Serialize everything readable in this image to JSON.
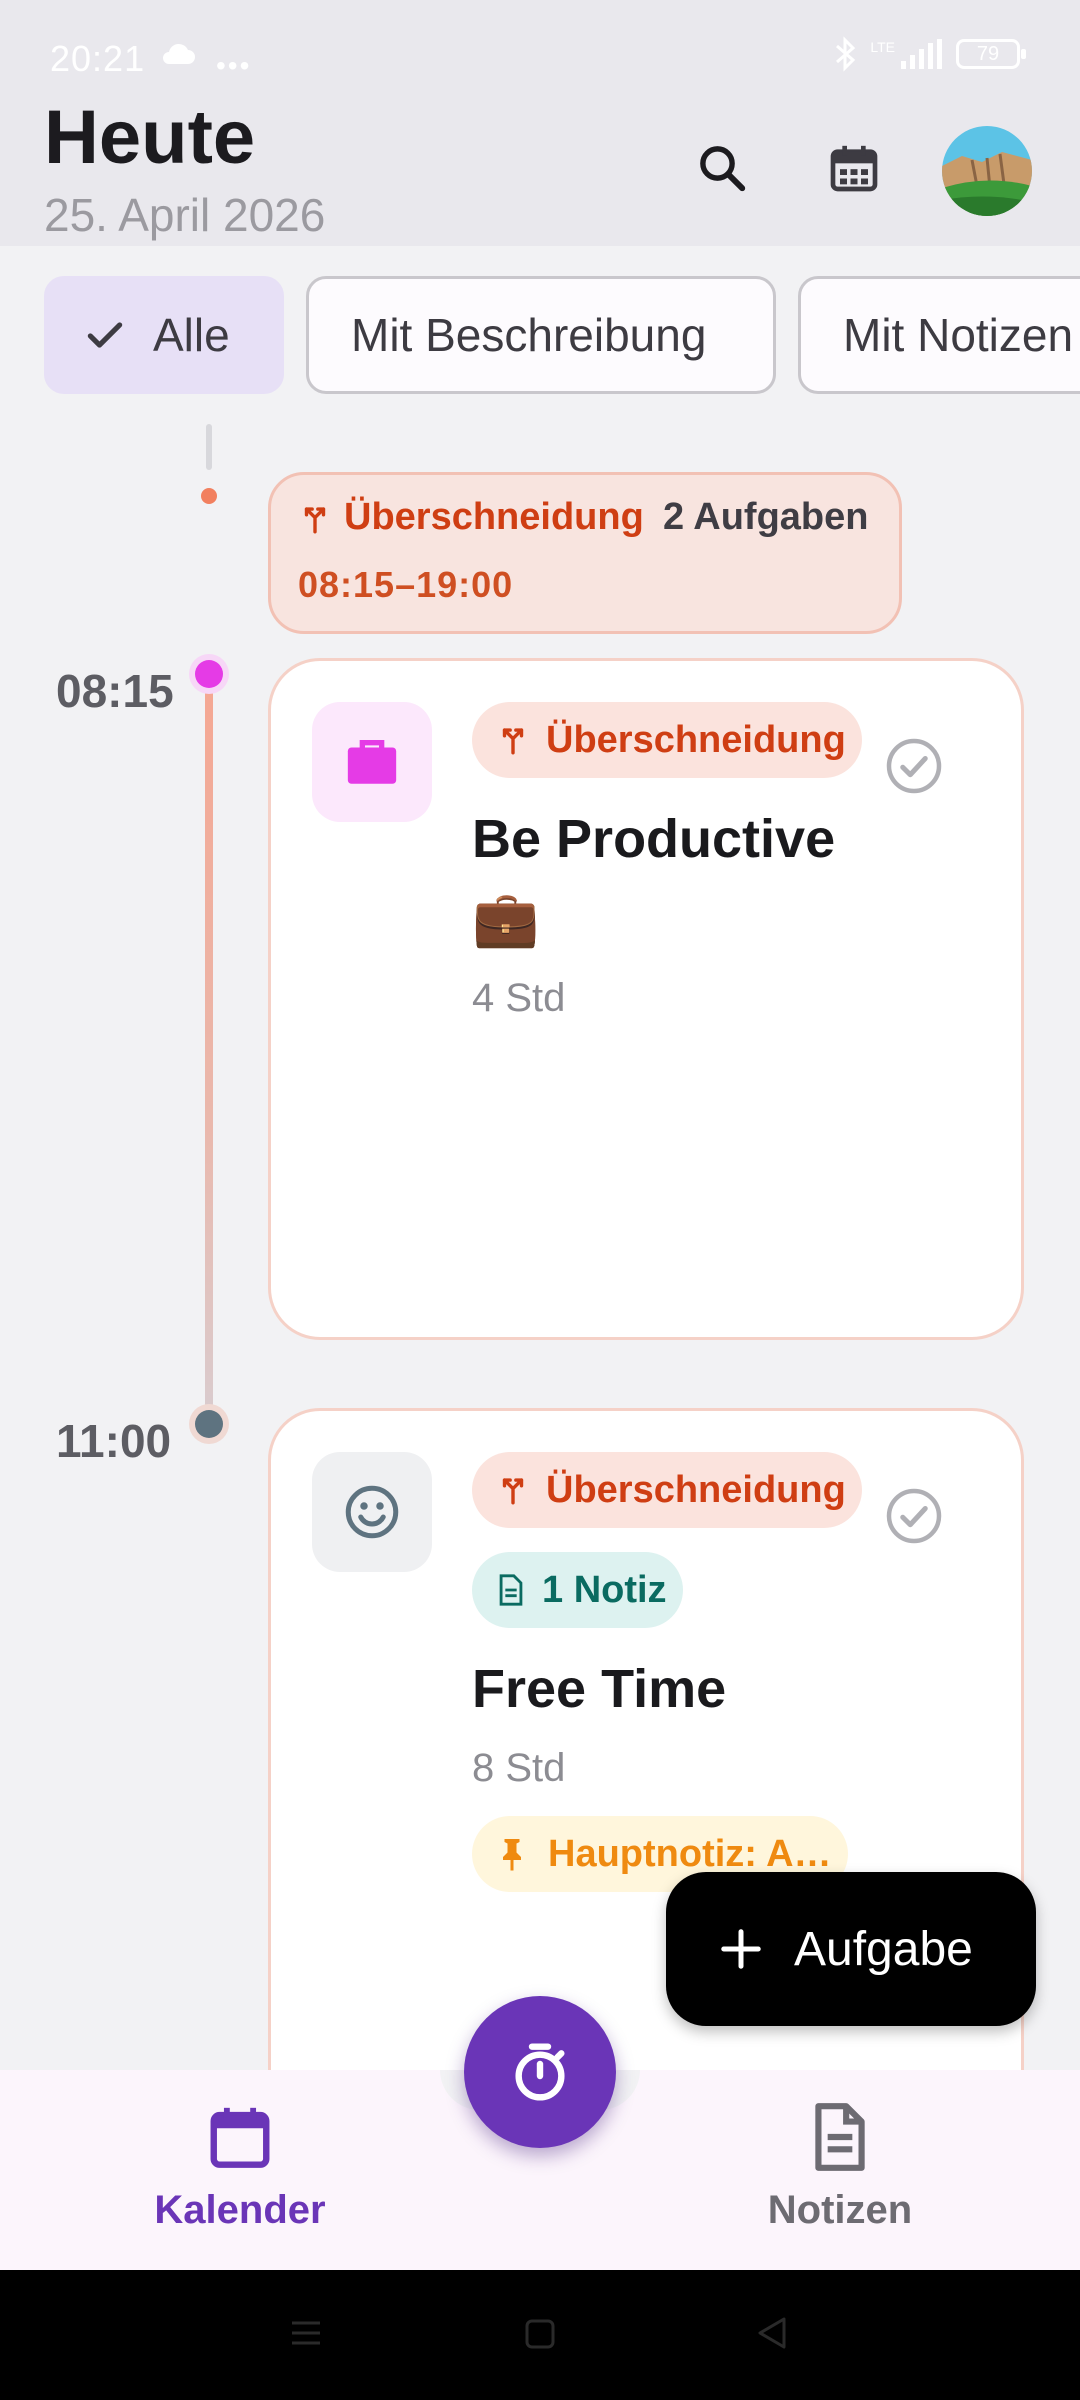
{
  "status": {
    "time": "20:21",
    "battery": "79",
    "network": "LTE"
  },
  "header": {
    "title": "Heute",
    "date": "25. April 2026"
  },
  "filters": [
    {
      "label": "Alle",
      "selected": true
    },
    {
      "label": "Mit Beschreibung",
      "selected": false
    },
    {
      "label": "Mit Notizen",
      "selected": false
    }
  ],
  "overlap_summary": {
    "label": "Überschneidung",
    "count": "2 Aufgaben",
    "range": "08:15–19:00"
  },
  "tasks": [
    {
      "time": "08:15",
      "icon": "briefcase-icon",
      "badge": "Überschneidung",
      "title": "Be Productive",
      "emoji": "💼",
      "duration": "4 Std",
      "color": "#e53be6"
    },
    {
      "time": "11:00",
      "icon": "smiley-icon",
      "badge": "Überschneidung",
      "note_badge": "1 Notiz",
      "title": "Free Time",
      "duration": "8 Std",
      "main_note": "Hauptnotiz: A…",
      "color": "#5e7380"
    }
  ],
  "fab": {
    "add_label": "Aufgabe"
  },
  "nav": {
    "calendar": "Kalender",
    "notes": "Notizen"
  },
  "colors": {
    "accent": "#6a35b7",
    "overlap": "#cf3e13",
    "note": "#0a6b61",
    "main_note": "#ef8a10"
  }
}
